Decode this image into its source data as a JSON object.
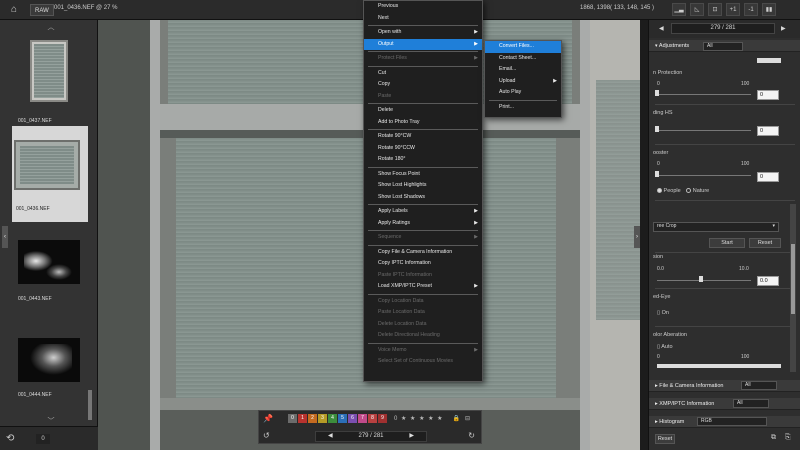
{
  "topbar": {
    "format_label": "RAW",
    "file_info": "001_0436.NEF @ 27 %",
    "coords": "1868, 1398( 133, 148, 145 )",
    "icons": [
      "histogram-icon",
      "sharpen-icon",
      "focus-icon",
      "highlight-icon",
      "shadow-icon",
      "compare-icon"
    ]
  },
  "filmstrip": {
    "items": [
      {
        "label": "001_0437.NEF",
        "selected": false
      },
      {
        "label": "001_0436.NEF",
        "selected": true
      },
      {
        "label": "001_0443.NEF",
        "selected": false
      },
      {
        "label": "001_0444.NEF",
        "selected": false
      }
    ],
    "count": "0"
  },
  "context_menu": {
    "items": [
      {
        "label": "Previous",
        "disabled": false,
        "sub": false
      },
      {
        "label": "Next",
        "disabled": false,
        "sub": false
      },
      {
        "sep": true
      },
      {
        "label": "Open with",
        "disabled": false,
        "sub": true
      },
      {
        "label": "Output",
        "disabled": false,
        "sub": true,
        "highlighted": true
      },
      {
        "sep": true
      },
      {
        "label": "Protect Files",
        "disabled": true,
        "sub": true
      },
      {
        "sep": true
      },
      {
        "label": "Cut",
        "disabled": false,
        "sub": false
      },
      {
        "label": "Copy",
        "disabled": false,
        "sub": false
      },
      {
        "label": "Paste",
        "disabled": true,
        "sub": false
      },
      {
        "sep": true
      },
      {
        "label": "Delete",
        "disabled": false,
        "sub": false
      },
      {
        "label": "Add to Photo Tray",
        "disabled": false,
        "sub": false
      },
      {
        "sep": true
      },
      {
        "label": "Rotate 90°CW",
        "disabled": false,
        "sub": false
      },
      {
        "label": "Rotate 90°CCW",
        "disabled": false,
        "sub": false
      },
      {
        "label": "Rotate 180°",
        "disabled": false,
        "sub": false
      },
      {
        "sep": true
      },
      {
        "label": "Show Focus Point",
        "disabled": false,
        "sub": false
      },
      {
        "label": "Show Lost Highlights",
        "disabled": false,
        "sub": false
      },
      {
        "label": "Show Lost Shadows",
        "disabled": false,
        "sub": false
      },
      {
        "sep": true
      },
      {
        "label": "Apply Labels",
        "disabled": false,
        "sub": true
      },
      {
        "label": "Apply Ratings",
        "disabled": false,
        "sub": true
      },
      {
        "sep": true
      },
      {
        "label": "Sequence",
        "disabled": true,
        "sub": true
      },
      {
        "sep": true
      },
      {
        "label": "Copy File & Camera Information",
        "disabled": false,
        "sub": false
      },
      {
        "label": "Copy IPTC Information",
        "disabled": false,
        "sub": false
      },
      {
        "label": "Paste IPTC Information",
        "disabled": true,
        "sub": false
      },
      {
        "label": "Load XMP/IPTC Preset",
        "disabled": false,
        "sub": true
      },
      {
        "sep": true
      },
      {
        "label": "Copy Location Data",
        "disabled": true,
        "sub": false
      },
      {
        "label": "Paste Location Data",
        "disabled": true,
        "sub": false
      },
      {
        "label": "Delete Location Data",
        "disabled": true,
        "sub": false
      },
      {
        "label": "Delete Directional Heading",
        "disabled": true,
        "sub": false
      },
      {
        "sep": true
      },
      {
        "label": "Voice Memo",
        "disabled": true,
        "sub": true
      },
      {
        "label": "Select Set of Continuous Movies",
        "disabled": true,
        "sub": false
      }
    ]
  },
  "output_submenu": {
    "items": [
      {
        "label": "Convert Files...",
        "highlighted": true,
        "sub": false
      },
      {
        "label": "Contact Sheet...",
        "highlighted": false,
        "sub": false
      },
      {
        "label": "Email...",
        "highlighted": false,
        "sub": false
      },
      {
        "label": "Upload",
        "highlighted": false,
        "sub": true
      },
      {
        "label": "Auto Play",
        "highlighted": false,
        "sub": false
      },
      {
        "sep": true
      },
      {
        "label": "Print...",
        "highlighted": false,
        "sub": false
      }
    ]
  },
  "bottom_toolbar": {
    "labels": [
      "0",
      "1",
      "2",
      "3",
      "4",
      "5",
      "6",
      "7",
      "8",
      "9"
    ],
    "label_colors": [
      "#6b6b6b",
      "#b8322e",
      "#c46a20",
      "#b59a26",
      "#3c8d3c",
      "#2b6fb8",
      "#7a4fb0",
      "#c04a8a",
      "#b84040",
      "#a03030"
    ],
    "stars": "0 ★ ★ ★ ★ ★",
    "page": "279 / 281"
  },
  "right_panel": {
    "page": "279 / 281",
    "adjustments_title": "Adjustments",
    "adjustments_option": "All",
    "sections": {
      "protection": {
        "title": "n Protection",
        "min": "0",
        "max": "100",
        "value": "0"
      },
      "ding": {
        "title": "ding HS",
        "value": "0"
      },
      "booster": {
        "title": "ooster",
        "min": "0",
        "max": "100",
        "value": "0",
        "radio1": "People",
        "radio2": "Nature"
      },
      "crop": {
        "dropdown": "ree Crop",
        "start": "Start",
        "reset": "Reset"
      },
      "sion": {
        "title": "sion",
        "min": "0.0",
        "max": "10.0",
        "value": "0.0"
      },
      "redeye": {
        "title": "ed-Eye",
        "state": "On"
      },
      "aberration": {
        "title": "olor Aberation",
        "state": "Auto",
        "min": "0",
        "max": "100"
      }
    },
    "file_camera": {
      "title": "File & Camera Information",
      "option": "All"
    },
    "xmp": {
      "title": "XMP/IPTC Information",
      "option": "All"
    },
    "histogram": {
      "title": "Histogram",
      "option": "RGB"
    },
    "reset_button": "Reset"
  }
}
